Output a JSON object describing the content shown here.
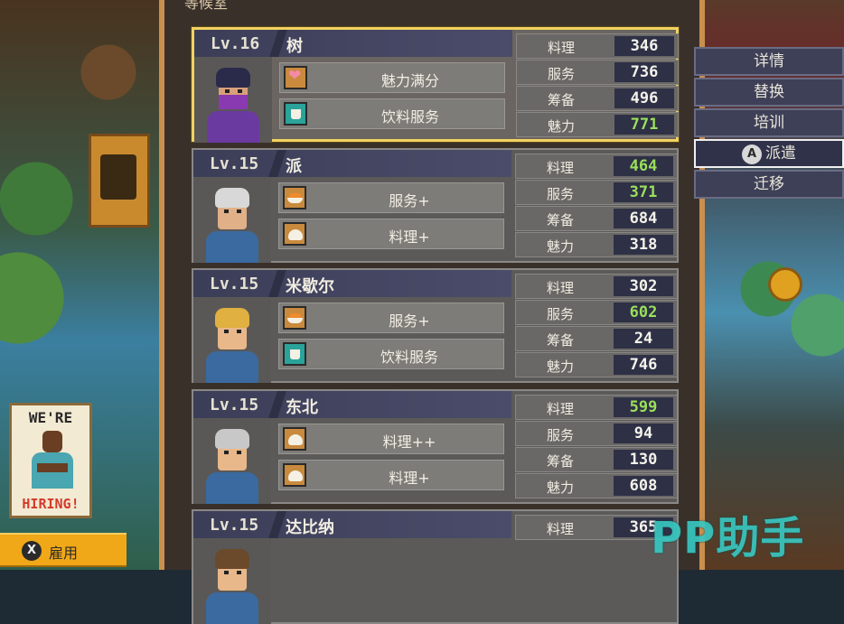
{
  "panel": {
    "title": "等候室"
  },
  "staff": [
    {
      "level": "Lv.16",
      "name": "树",
      "selected": true,
      "traits": [
        {
          "icon": "heart-icon",
          "label": "魅力满分"
        },
        {
          "icon": "cup-icon",
          "label": "饮料服务"
        }
      ],
      "stats": [
        {
          "name": "料理",
          "value": "346",
          "highlight": false
        },
        {
          "name": "服务",
          "value": "736",
          "highlight": false
        },
        {
          "name": "筹备",
          "value": "496",
          "highlight": false
        },
        {
          "name": "魅力",
          "value": "771",
          "highlight": true
        }
      ]
    },
    {
      "level": "Lv.15",
      "name": "派",
      "selected": false,
      "traits": [
        {
          "icon": "sushi-dish-icon",
          "label": "服务+"
        },
        {
          "icon": "bun-dish-icon",
          "label": "料理+"
        }
      ],
      "stats": [
        {
          "name": "料理",
          "value": "464",
          "highlight": true
        },
        {
          "name": "服务",
          "value": "371",
          "highlight": true
        },
        {
          "name": "筹备",
          "value": "684",
          "highlight": false
        },
        {
          "name": "魅力",
          "value": "318",
          "highlight": false
        }
      ]
    },
    {
      "level": "Lv.15",
      "name": "米歇尔",
      "selected": false,
      "traits": [
        {
          "icon": "sushi-dish-icon",
          "label": "服务+"
        },
        {
          "icon": "cup-icon",
          "label": "饮料服务"
        }
      ],
      "stats": [
        {
          "name": "料理",
          "value": "302",
          "highlight": false
        },
        {
          "name": "服务",
          "value": "602",
          "highlight": true
        },
        {
          "name": "筹备",
          "value": "24",
          "highlight": false
        },
        {
          "name": "魅力",
          "value": "746",
          "highlight": false
        }
      ]
    },
    {
      "level": "Lv.15",
      "name": "东北",
      "selected": false,
      "traits": [
        {
          "icon": "bun-dish-icon",
          "label": "料理++"
        },
        {
          "icon": "bun-dish-icon",
          "label": "料理+"
        }
      ],
      "stats": [
        {
          "name": "料理",
          "value": "599",
          "highlight": true
        },
        {
          "name": "服务",
          "value": "94",
          "highlight": false
        },
        {
          "name": "筹备",
          "value": "130",
          "highlight": false
        },
        {
          "name": "魅力",
          "value": "608",
          "highlight": false
        }
      ]
    },
    {
      "level": "Lv.15",
      "name": "达比纳",
      "selected": false,
      "traits": [],
      "stats": [
        {
          "name": "料理",
          "value": "365",
          "highlight": false
        }
      ]
    }
  ],
  "menu": {
    "items": [
      {
        "label": "详情",
        "button": ""
      },
      {
        "label": "替换",
        "button": ""
      },
      {
        "label": "培训",
        "button": ""
      },
      {
        "label": "派遣",
        "button": "A"
      },
      {
        "label": "迁移",
        "button": ""
      }
    ]
  },
  "poster": {
    "top_text": "WE'RE",
    "bottom_text": "HIRING!"
  },
  "hire": {
    "button": "X",
    "label": "雇用"
  },
  "watermark": {
    "text": "PP助手"
  },
  "colors": {
    "accent_gold": "#f2d260",
    "highlight_green": "#9ae05a",
    "hire_orange": "#f0a818",
    "stat_box": "#2e3046"
  }
}
